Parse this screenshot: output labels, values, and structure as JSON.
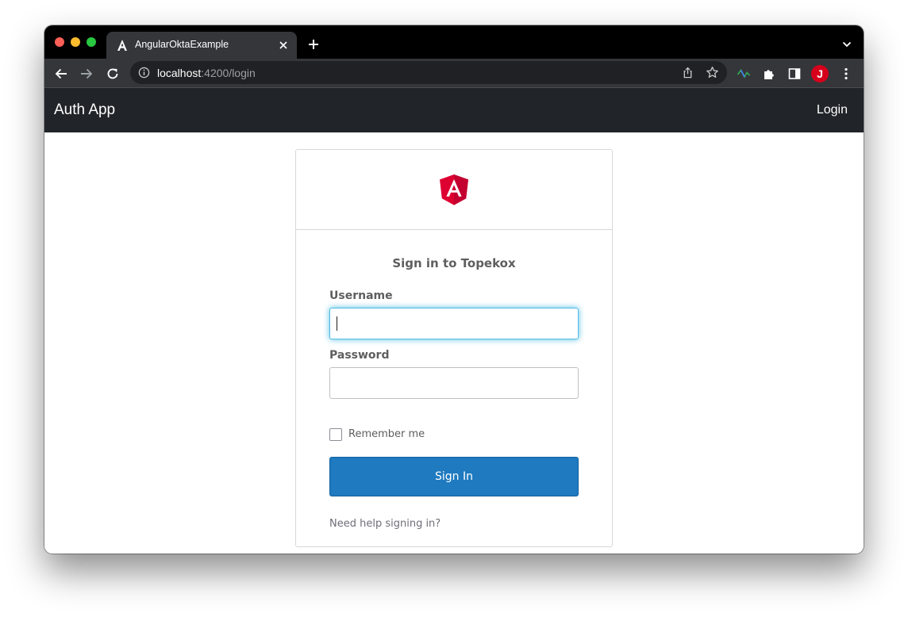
{
  "browser": {
    "tab_title": "AngularOktaExample",
    "url_host": "localhost",
    "url_path": ":4200/login",
    "profile_initial": "J",
    "icons": [
      "angular-favicon-icon",
      "close-icon",
      "plus-icon",
      "chevron-down-icon",
      "back-icon",
      "forward-icon",
      "reload-icon",
      "info-icon",
      "share-icon",
      "star-icon",
      "extension-pulse-icon",
      "puzzle-icon",
      "sidebar-icon",
      "kebab-menu-icon"
    ]
  },
  "navbar": {
    "brand": "Auth App",
    "login_link": "Login"
  },
  "signin": {
    "title": "Sign in to Topekox",
    "username_label": "Username",
    "username_value": "",
    "password_label": "Password",
    "password_value": "",
    "remember_label": "Remember me",
    "remember_checked": false,
    "submit_label": "Sign In",
    "help_link": "Need help signing in?"
  },
  "colors": {
    "navbar_bg": "#212529",
    "button_bg": "#1f7ac0",
    "focus_ring": "#51bce3",
    "angular_red": "#dd0031"
  }
}
